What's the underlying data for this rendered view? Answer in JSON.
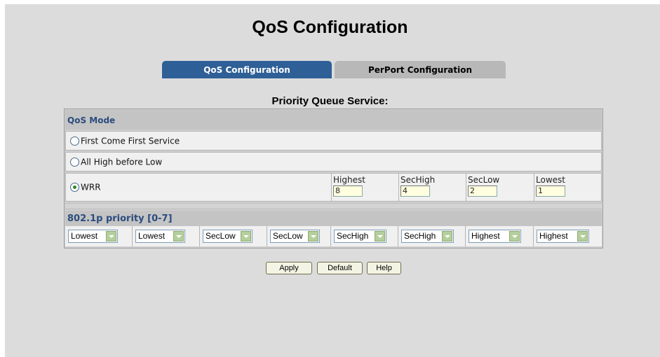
{
  "page": {
    "title": "QoS Configuration"
  },
  "tabs": [
    {
      "label": "QoS Configuration",
      "active": true
    },
    {
      "label": "PerPort Configuration",
      "active": false
    }
  ],
  "section_title": "Priority Queue Service:",
  "qos_mode": {
    "header": "QoS Mode",
    "options": [
      {
        "label": "First Come First Service",
        "selected": false
      },
      {
        "label": "All High before Low",
        "selected": false
      },
      {
        "label": "WRR",
        "selected": true
      }
    ],
    "wrr": [
      {
        "label": "Highest",
        "value": "8"
      },
      {
        "label": "SecHigh",
        "value": "4"
      },
      {
        "label": "SecLow",
        "value": "2"
      },
      {
        "label": "Lowest",
        "value": "1"
      }
    ]
  },
  "priority": {
    "header": "802.1p priority [0-7]",
    "values": [
      "Lowest",
      "Lowest",
      "SecLow",
      "SecLow",
      "SecHigh",
      "SecHigh",
      "Highest",
      "Highest"
    ]
  },
  "buttons": {
    "apply": "Apply",
    "default": "Default",
    "help": "Help"
  },
  "colors": {
    "active_tab": "#2e5f97",
    "header_text": "#2b4c7e",
    "background": "#dcdcdc"
  }
}
